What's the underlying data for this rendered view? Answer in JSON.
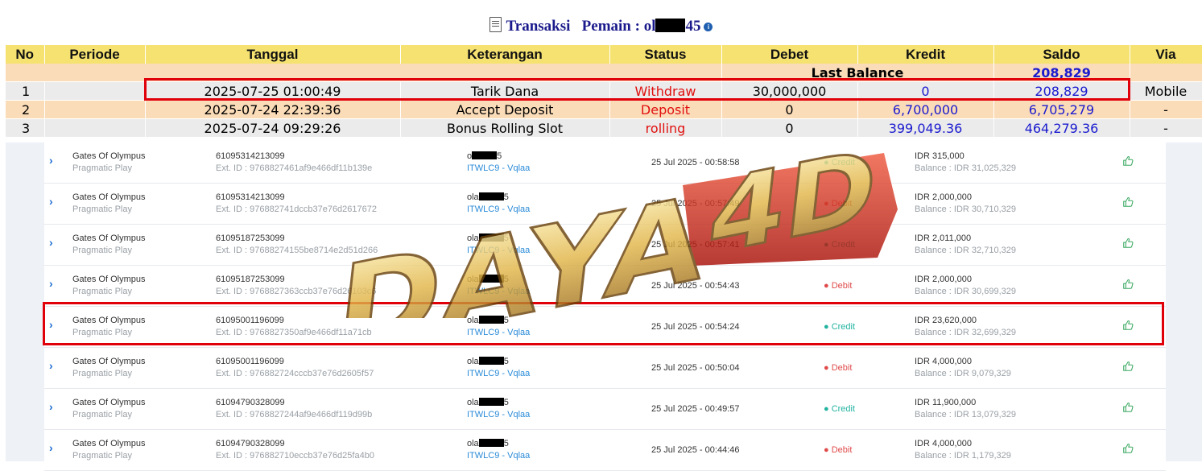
{
  "title": {
    "prefix": "Transaksi   Pemain : ol",
    "suffix": "45",
    "info": "i"
  },
  "table": {
    "headers": [
      "No",
      "Periode",
      "Tanggal",
      "Keterangan",
      "Status",
      "Debet",
      "Kredit",
      "Saldo",
      "Via"
    ],
    "last_balance_label": "Last Balance",
    "last_balance_value": "208,829",
    "rows": [
      {
        "no": "1",
        "periode": "",
        "tanggal": "2025-07-25 01:00:49",
        "keterangan": "Tarik Dana",
        "status": "Withdraw",
        "debet": "30,000,000",
        "kredit": "0",
        "saldo": "208,829",
        "via": "Mobile"
      },
      {
        "no": "2",
        "periode": "",
        "tanggal": "2025-07-24 22:39:36",
        "keterangan": "Accept Deposit",
        "status": "Deposit",
        "debet": "0",
        "kredit": "6,700,000",
        "saldo": "6,705,279",
        "via": "-"
      },
      {
        "no": "3",
        "periode": "",
        "tanggal": "2025-07-24 09:29:26",
        "keterangan": "Bonus Rolling Slot",
        "status": "rolling",
        "debet": "0",
        "kredit": "399,049.36",
        "saldo": "464,279.36",
        "via": "-"
      }
    ]
  },
  "list": [
    {
      "game": "Gates Of Olympus",
      "provider": "Pragmatic Play",
      "tid": "61095314213099",
      "ext": "Ext. ID : 9768827461af9e466df11b139e",
      "user_pre": "o",
      "user_suf": "5",
      "site": "ITWLC9 - Vqlaa",
      "date": "25 Jul 2025 - 00:58:58",
      "type": "Credit",
      "amount": "IDR 315,000",
      "balance": "Balance : IDR 31,025,329"
    },
    {
      "game": "Gates Of Olympus",
      "provider": "Pragmatic Play",
      "tid": "61095314213099",
      "ext": "Ext. ID : 976882741dccb37e76d2617672",
      "user_pre": "ola",
      "user_suf": "5",
      "site": "ITWLC9 - Vqlaa",
      "date": "25 Jul 2025 - 00:57:49",
      "type": "Debit",
      "amount": "IDR 2,000,000",
      "balance": "Balance : IDR 30,710,329"
    },
    {
      "game": "Gates Of Olympus",
      "provider": "Pragmatic Play",
      "tid": "61095187253099",
      "ext": "Ext. ID : 97688274155be8714e2d51d266",
      "user_pre": "ola",
      "user_suf": "5",
      "site": "ITWLC9 - Vqlaa",
      "date": "25 Jul 2025 - 00:57:41",
      "type": "Credit",
      "amount": "IDR 2,011,000",
      "balance": "Balance : IDR 32,710,329"
    },
    {
      "game": "Gates Of Olympus",
      "provider": "Pragmatic Play",
      "tid": "61095187253099",
      "ext": "Ext. ID : 9768827363ccb37e76d26103c6",
      "user_pre": "ola",
      "user_suf": "5",
      "site": "ITWLC9 - Vqlaa",
      "date": "25 Jul 2025 - 00:54:43",
      "type": "Debit",
      "amount": "IDR 2,000,000",
      "balance": "Balance : IDR 30,699,329"
    },
    {
      "game": "Gates Of Olympus",
      "provider": "Pragmatic Play",
      "tid": "61095001196099",
      "ext": "Ext. ID : 9768827350af9e466df11a71cb",
      "user_pre": "ola",
      "user_suf": "5",
      "site": "ITWLC9 - Vqlaa",
      "date": "25 Jul 2025 - 00:54:24",
      "type": "Credit",
      "amount": "IDR 23,620,000",
      "balance": "Balance : IDR 32,699,329"
    },
    {
      "game": "Gates Of Olympus",
      "provider": "Pragmatic Play",
      "tid": "61095001196099",
      "ext": "Ext. ID : 976882724cccb37e76d2605f57",
      "user_pre": "ola",
      "user_suf": "5",
      "site": "ITWLC9 - Vqlaa",
      "date": "25 Jul 2025 - 00:50:04",
      "type": "Debit",
      "amount": "IDR 4,000,000",
      "balance": "Balance : IDR 9,079,329"
    },
    {
      "game": "Gates Of Olympus",
      "provider": "Pragmatic Play",
      "tid": "61094790328099",
      "ext": "Ext. ID : 9768827244af9e466df119d99b",
      "user_pre": "ola",
      "user_suf": "5",
      "site": "ITWLC9 - Vqlaa",
      "date": "25 Jul 2025 - 00:49:57",
      "type": "Credit",
      "amount": "IDR 11,900,000",
      "balance": "Balance : IDR 13,079,329"
    },
    {
      "game": "Gates Of Olympus",
      "provider": "Pragmatic Play",
      "tid": "61094790328099",
      "ext": "Ext. ID : 976882710eccb37e76d25fa4b0",
      "user_pre": "ola",
      "user_suf": "5",
      "site": "ITWLC9 - Vqlaa",
      "date": "25 Jul 2025 - 00:44:46",
      "type": "Debit",
      "amount": "IDR 4,000,000",
      "balance": "Balance : IDR 1,179,329"
    }
  ],
  "watermark": {
    "text": "DAYA4D"
  },
  "colors": {
    "header_bg": "#f5e271",
    "highlight": "#e0000a",
    "credit": "#22b3a0",
    "debit": "#e04a4a",
    "link": "#2a8bd8"
  }
}
